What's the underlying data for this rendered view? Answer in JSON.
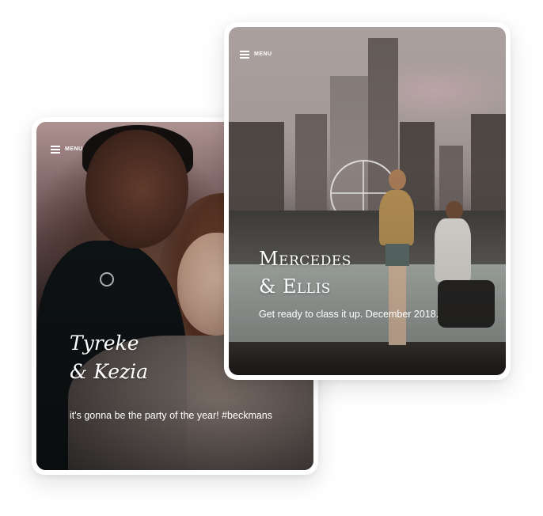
{
  "cards": [
    {
      "menu_label": "MENU",
      "title_line1": "Tyreke",
      "title_line2": "& Kezia",
      "tagline": "it's gonna be the party of the year! #beckmans"
    },
    {
      "menu_label": "MENU",
      "title_line1": "Mercedes",
      "title_line2": "& Ellis",
      "tagline": "Get ready to class it up. December 2018."
    }
  ],
  "icons": {
    "menu": "hamburger-menu-icon"
  },
  "colors": {
    "text": "#ffffff",
    "card_border": "#ffffff"
  }
}
